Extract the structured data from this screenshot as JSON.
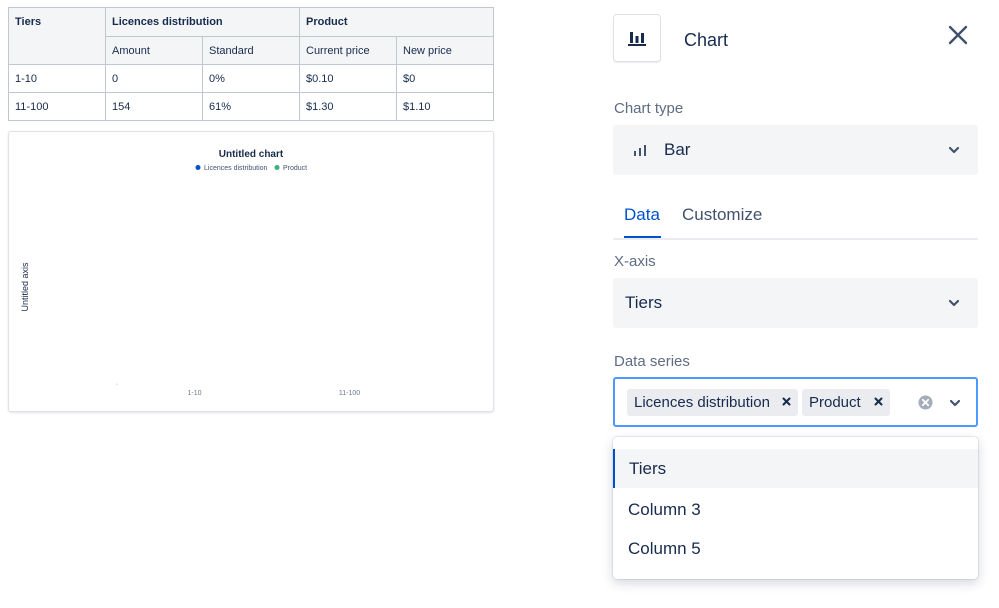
{
  "table": {
    "group_headers": {
      "tiers": "Tiers",
      "licences": "Licences distribution",
      "product": "Product"
    },
    "sub_headers": [
      "Amount",
      "Standard",
      "Current price",
      "New price"
    ],
    "rows": [
      [
        "1-10",
        "0",
        "0%",
        "$0.10",
        "$0"
      ],
      [
        "11-100",
        "154",
        "61%",
        "$1.30",
        "$1.10"
      ]
    ]
  },
  "chart_data": {
    "type": "bar",
    "title": "Untitled chart",
    "xlabel": "",
    "ylabel": "Untitled axis",
    "categories": [
      "1-10",
      "11-100"
    ],
    "series": [
      {
        "name": "Licences distribution",
        "color": "#0052cc",
        "values": [
          null,
          null
        ]
      },
      {
        "name": "Product",
        "color": "#36b37e",
        "values": [
          null,
          null
        ]
      }
    ],
    "legend": "top",
    "grid": false
  },
  "panel": {
    "title": "Chart",
    "header_icon": "bar-chart-icon",
    "close_icon": "close-icon",
    "chart_type": {
      "label": "Chart type",
      "value": "Bar",
      "icon": "bar-chart-icon"
    },
    "tabs": [
      "Data",
      "Customize"
    ],
    "active_tab": "Data",
    "x_axis": {
      "label": "X-axis",
      "value": "Tiers"
    },
    "data_series": {
      "label": "Data series",
      "selected": [
        "Licences distribution",
        "Product"
      ],
      "clear_icon": "clear-icon",
      "options": [
        "Tiers",
        "Column 3",
        "Column 5"
      ],
      "highlighted": "Tiers"
    }
  },
  "colors": {
    "accent": "#0052cc",
    "focus_border": "#4c9aff",
    "series_1": "#0052cc",
    "series_2": "#36b37e"
  }
}
